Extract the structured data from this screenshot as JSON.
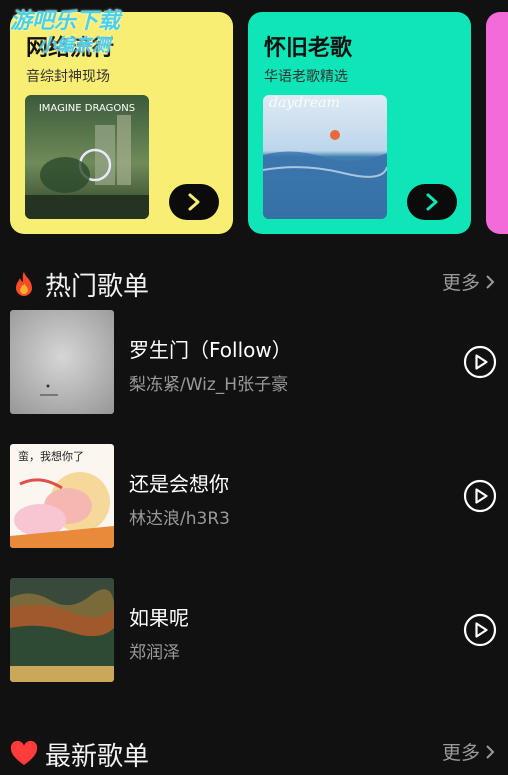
{
  "watermark": {
    "line1": "游吧乐下载",
    "line2": "小编亲测"
  },
  "cards": [
    {
      "title": "网络流行",
      "subtitle": "音综封神现场",
      "bg": "#f8ee73",
      "cover_text": "IMAGINE DRAGONS",
      "button_icon": "chevron-right-icon"
    },
    {
      "title": "怀旧老歌",
      "subtitle": "华语老歌精选",
      "bg": "#0ee6b8",
      "cover_text": "daydream",
      "button_icon": "chevron-right-icon"
    },
    {
      "bg": "#f26bd9"
    }
  ],
  "hot_section": {
    "title": "热门歌单",
    "more": "更多",
    "icon": "flame-icon"
  },
  "songs": [
    {
      "name": "罗生门（Follow）",
      "artist": "梨冻紧/Wiz_H张子豪",
      "play_icon": "play-circle-icon"
    },
    {
      "name": "还是会想你",
      "artist": "林达浪/h3R3",
      "play_icon": "play-circle-icon",
      "cover_caption": "蛮，我想你了"
    },
    {
      "name": "如果呢",
      "artist": "郑润泽",
      "play_icon": "play-circle-icon"
    }
  ],
  "new_section": {
    "title": "最新歌单",
    "more": "更多",
    "icon": "heart-icon"
  },
  "colors": {
    "background": "#111111",
    "muted_text": "#9a9a9a",
    "accent_yellow": "#f8ee73",
    "accent_green": "#0ee6b8",
    "accent_pink": "#f26bd9"
  }
}
